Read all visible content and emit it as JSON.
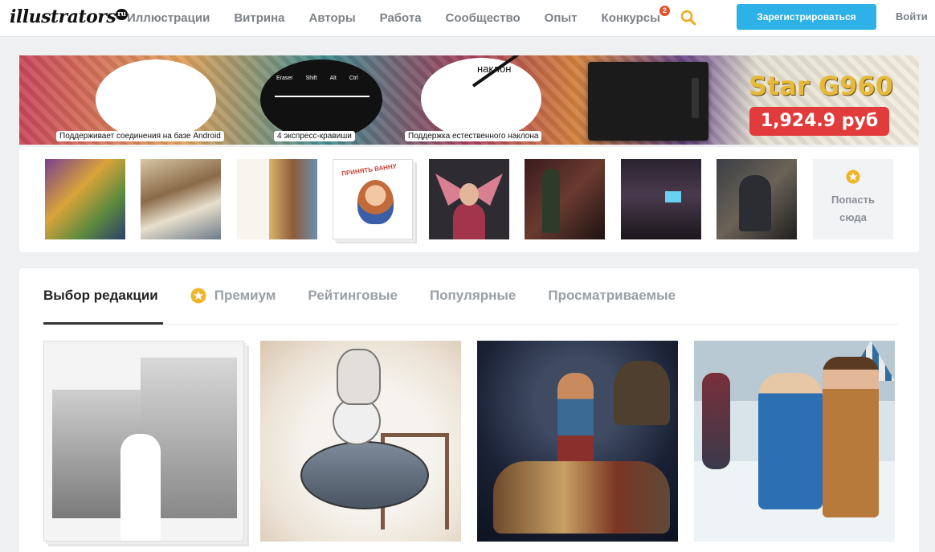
{
  "header": {
    "logo_text": "illustrators",
    "logo_suffix": "ru",
    "nav": [
      "Иллюстрации",
      "Витрина",
      "Авторы",
      "Работа",
      "Сообщество",
      "Опыт",
      "Конкурсы"
    ],
    "contests_badge": "2",
    "register_label": "Зарегистрироваться",
    "login_label": "Войти"
  },
  "banner": {
    "caption_android": "Поддерживает соединения на базе Android",
    "caption_keys": "4 экспресс-кравиши",
    "caption_tilt": "Поддержка естественного наклона",
    "keys": [
      "Eraser",
      "Shift",
      "Alt",
      "Ctrl"
    ],
    "tilt_label": "наклон",
    "product_name": "Star G960",
    "price": "1,924.9 руб"
  },
  "thumbnails": {
    "stamp_text": "ПРИНЯТЬ ВАННУ",
    "placeholder_label": "Попасть сюда"
  },
  "tabs": [
    "Выбор редакции",
    "Премиум",
    "Рейтинговые",
    "Популярные",
    "Просматриваемые"
  ],
  "colors": {
    "accent": "#2eb1e6",
    "badge": "#e0532a",
    "star": "#f0b429",
    "price_bg": "#e13b3b"
  }
}
